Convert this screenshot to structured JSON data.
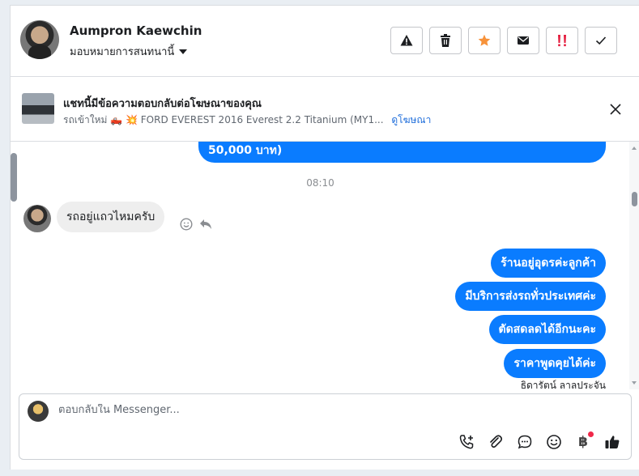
{
  "header": {
    "contact_name": "Aumpron Kaewchin",
    "assign_label": "มอบหมายการสนทนานี้",
    "tools": [
      "alert-icon",
      "trash-icon",
      "star-icon",
      "mail-icon",
      "exclamation-icon",
      "check-icon"
    ]
  },
  "ad": {
    "title": "แชทนี้มีข้อความตอบกลับต่อโฆษณาของคุณ",
    "subtitle": "รถเข้าใหม่ 🛻 💥 FORD EVEREST 2016 Everest 2.2 Titanium (MY1...",
    "link": "ดูโฆษณา"
  },
  "chat": {
    "prev_bubble": "50,000 บาท)",
    "time": "08:10",
    "incoming": "รถอยู่แถวไหมครับ",
    "outgoing": [
      "ร้านอยู่อุดรค่ะลูกค้า",
      "มีบริการส่งรถทั่วประเทศค่ะ",
      "ตัดสดลดได้อีกนะคะ",
      "ราคาพูดคุยได้ค่ะ"
    ],
    "signer": "ธิดารัตน์ ลาลประจัน"
  },
  "composer": {
    "placeholder": "ตอบกลับใน Messenger...",
    "tools": [
      "phone-add-icon",
      "attach-icon",
      "chat-bubble-icon",
      "emoji-icon",
      "baht-icon",
      "thumbs-up-icon"
    ]
  },
  "colors": {
    "bubble_out": "#0a7cff",
    "bubble_in": "#eeeeee",
    "star": "#f7923a",
    "urgent": "#e41e3f",
    "link": "#216fdb"
  }
}
